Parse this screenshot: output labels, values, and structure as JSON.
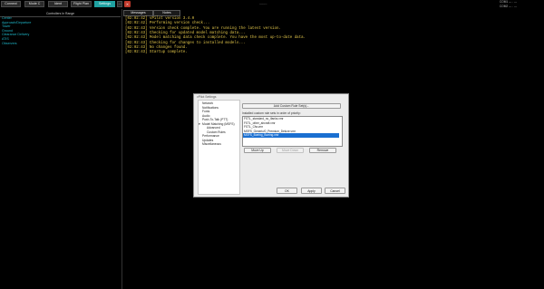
{
  "toolbar": {
    "connect_label": "Connect",
    "mode_label": "Mode C",
    "ident_label": "Ident",
    "flight_plan_label": "Flight Plan",
    "settings_label": "Settings",
    "extra_label": "...",
    "close_label": "X",
    "callsign": "--------"
  },
  "freq_panel": {
    "com1_label": "COM1",
    "com1_value": "--- . ---",
    "com2_label": "COM2",
    "com2_value": "--- . ---"
  },
  "sidebar": {
    "header": "Controllers In Range",
    "items": [
      {
        "label": "Center"
      },
      {
        "label": "Approach/Departure"
      },
      {
        "label": "Tower"
      },
      {
        "label": "Ground"
      },
      {
        "label": "Clearance Delivery"
      },
      {
        "label": "ATIS"
      },
      {
        "label": "Observers"
      }
    ]
  },
  "tabs": [
    {
      "label": "Messages"
    },
    {
      "label": "Notes"
    }
  ],
  "log": [
    "[02:02:42] vPilot version 3.4.0",
    "[02:02:42] Performing version check...",
    "[02:02:43] Version check complete. You are running the latest version.",
    "[02:02:43] Checking for updated model matching data...",
    "[02:02:43] Model matching data check complete. You have the most up-to-date data.",
    "[02:02:43] Checking for changes to installed models...",
    "[02:02:43] No changes found.",
    "[02:02:43] Startup complete."
  ],
  "dialog": {
    "title": "vPilot Settings",
    "nav": [
      {
        "label": "Network"
      },
      {
        "label": "Notifications"
      },
      {
        "label": "Fonts"
      },
      {
        "label": "Audio"
      },
      {
        "label": "Push-To-Talk (PTT)"
      },
      {
        "label": "Model Matching (MSFS)"
      },
      {
        "label": "Advanced"
      },
      {
        "label": "Custom Rules"
      },
      {
        "label": "Performance"
      },
      {
        "label": "Updates"
      },
      {
        "label": "Miscellaneous"
      }
    ],
    "add_rule_label": "Add Custom Rule Set(s)...",
    "installed_label": "Installed custom rule sets in order of priority:",
    "rule_sets": [
      {
        "label": "FSTL_standard_no_ifanks.vmr"
      },
      {
        "label": "FSTL_other_aircraft.vmr"
      },
      {
        "label": "FSTL_Cfw.vmr"
      },
      {
        "label": "MSFS_Generic/0_Premium_Deluxe.vmr"
      },
      {
        "label": "MSFS_Boeing_Boeing.vmr"
      }
    ],
    "selected_index": 4,
    "move_up_label": "Move Up",
    "move_down_label": "Move Down",
    "remove_label": "Remove",
    "ok_label": "OK",
    "apply_label": "Apply",
    "cancel_label": "Cancel"
  }
}
